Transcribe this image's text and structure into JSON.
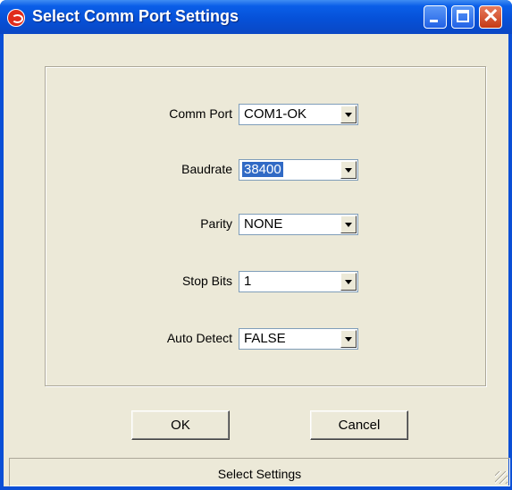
{
  "window": {
    "title": "Select Comm Port Settings"
  },
  "fields": [
    {
      "label": "Comm Port",
      "value": "COM1-OK",
      "selected": false
    },
    {
      "label": "Baudrate",
      "value": "38400",
      "selected": true
    },
    {
      "label": "Parity",
      "value": "NONE",
      "selected": false
    },
    {
      "label": "Stop Bits",
      "value": "1",
      "selected": false
    },
    {
      "label": "Auto Detect",
      "value": "FALSE",
      "selected": false
    }
  ],
  "buttons": {
    "ok": "OK",
    "cancel": "Cancel"
  },
  "status": {
    "text": "Select Settings"
  },
  "colors": {
    "titlebar": "#0651d8",
    "selection": "#316ac5",
    "face": "#ece9d8"
  },
  "icons": {
    "app": "app-icon",
    "minimize": "minimize-icon",
    "maximize": "maximize-icon",
    "close": "close-icon",
    "dropdown": "chevron-down-icon"
  }
}
